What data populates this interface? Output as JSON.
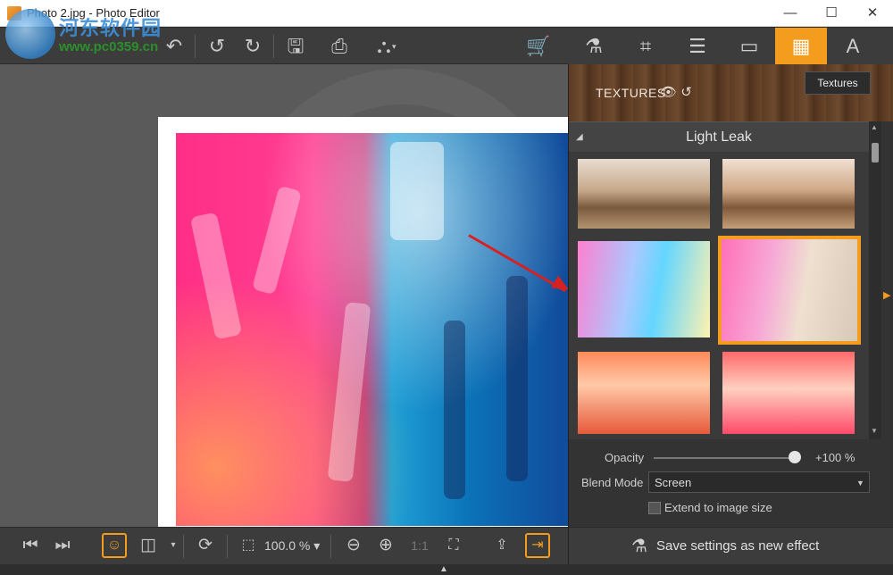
{
  "window": {
    "title": "Photo 2.jpg - Photo Editor",
    "controls": {
      "minimize": "—",
      "maximize": "☐",
      "close": "✕"
    }
  },
  "watermark": {
    "line1": "河东软件园",
    "line2": "www.pc0359.cn"
  },
  "toolbar": {
    "buttons": [
      {
        "name": "undo-all",
        "glyph": "↶"
      },
      {
        "name": "undo",
        "glyph": "↺"
      },
      {
        "name": "redo",
        "glyph": "↻"
      },
      {
        "name": "save",
        "glyph": "🖫"
      },
      {
        "name": "print",
        "glyph": "⎙"
      },
      {
        "name": "share",
        "glyph": "⛬"
      },
      {
        "name": "cart",
        "glyph": "🛒"
      }
    ]
  },
  "tabs": [
    {
      "name": "effects",
      "glyph": "⚗"
    },
    {
      "name": "crop",
      "glyph": "⌗"
    },
    {
      "name": "adjust",
      "glyph": "☰"
    },
    {
      "name": "frames",
      "glyph": "▭"
    },
    {
      "name": "textures",
      "glyph": "▦",
      "active": true
    },
    {
      "name": "text",
      "glyph": "A"
    }
  ],
  "panel": {
    "title": "TEXTURES",
    "tooltip": "Textures",
    "category": "Light Leak",
    "thumbnails": [
      {
        "style": "warm-sepia"
      },
      {
        "style": "warm-sepia-2"
      },
      {
        "style": "cyan-pink",
        "selected": false
      },
      {
        "style": "pink-glow",
        "selected": true
      },
      {
        "style": "red-orange"
      },
      {
        "style": "red-pink"
      }
    ]
  },
  "settings": {
    "opacity_label": "Opacity",
    "opacity_value": "+100 %",
    "opacity_fraction": 1.0,
    "blend_label": "Blend Mode",
    "blend_value": "Screen",
    "extend_label": "Extend to image size"
  },
  "bottombar": {
    "zoom": "100.0 %",
    "save_effect": "Save settings as new effect"
  },
  "colors": {
    "accent": "#f39c1e",
    "panel": "#333333",
    "toolbar": "#3c3c3c"
  }
}
